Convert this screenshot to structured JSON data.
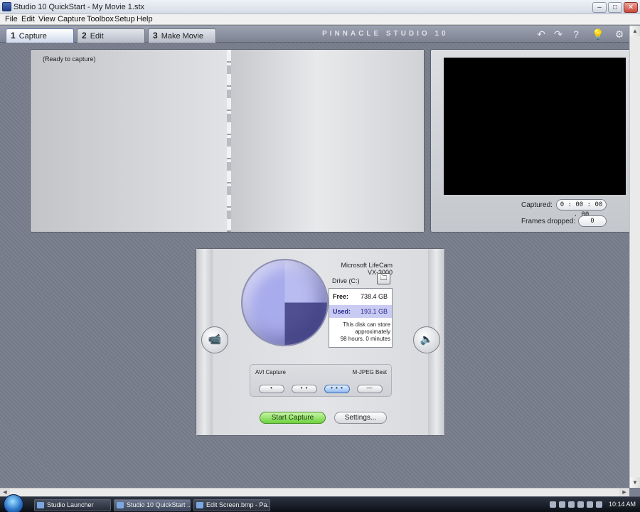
{
  "window": {
    "title": "Studio 10 QuickStart - My Movie 1.stx",
    "minimize": "–",
    "maximize": "□",
    "close": "✕"
  },
  "menu": [
    "File",
    "Edit",
    "View",
    "Capture",
    "Toolbox",
    "Setup",
    "Help"
  ],
  "tabs": [
    {
      "num": "1",
      "label": "Capture"
    },
    {
      "num": "2",
      "label": "Edit"
    },
    {
      "num": "3",
      "label": "Make Movie"
    }
  ],
  "brand": "PINNACLE STUDIO 10",
  "toolbar_icons": {
    "undo": "↶",
    "redo": "↷",
    "help": "?",
    "hint": "💡",
    "settings": "⚙"
  },
  "album": {
    "status": "(Ready to capture)"
  },
  "preview": {
    "captured_label": "Captured:",
    "captured_value": "0 : 00 : 00 . 00",
    "dropped_label": "Frames dropped:",
    "dropped_value": "0"
  },
  "capture": {
    "device": "Microsoft LifeCam VX-3000",
    "drive": "Drive (C:)",
    "folder_icon": "🗀",
    "free_label": "Free:",
    "free_value": "738.4 GB",
    "used_label": "Used:",
    "used_value": "193.1 GB",
    "note_line1": "This disk can store",
    "note_line2": "approximately",
    "note_line3": "98 hours, 0 minutes",
    "quality_left": "AVI Capture",
    "quality_right": "M-JPEG Best",
    "quality_buttons": [
      "•",
      "• •",
      "• • •",
      "—"
    ],
    "selected_quality": 2,
    "start_label": "Start Capture",
    "settings_label": "Settings...",
    "video_icon": "📹",
    "audio_icon": "🔈"
  },
  "taskbar": {
    "items": [
      "Studio Launcher",
      "Studio 10 QuickStart ...",
      "Edit Screen.bmp - Pa..."
    ],
    "clock": "10:14 AM"
  },
  "colors": {
    "accent": "#5e7bb0",
    "start_green": "#6cd23e",
    "disk_used": "#4f4f92",
    "disk_free": "#b9bcf0"
  }
}
